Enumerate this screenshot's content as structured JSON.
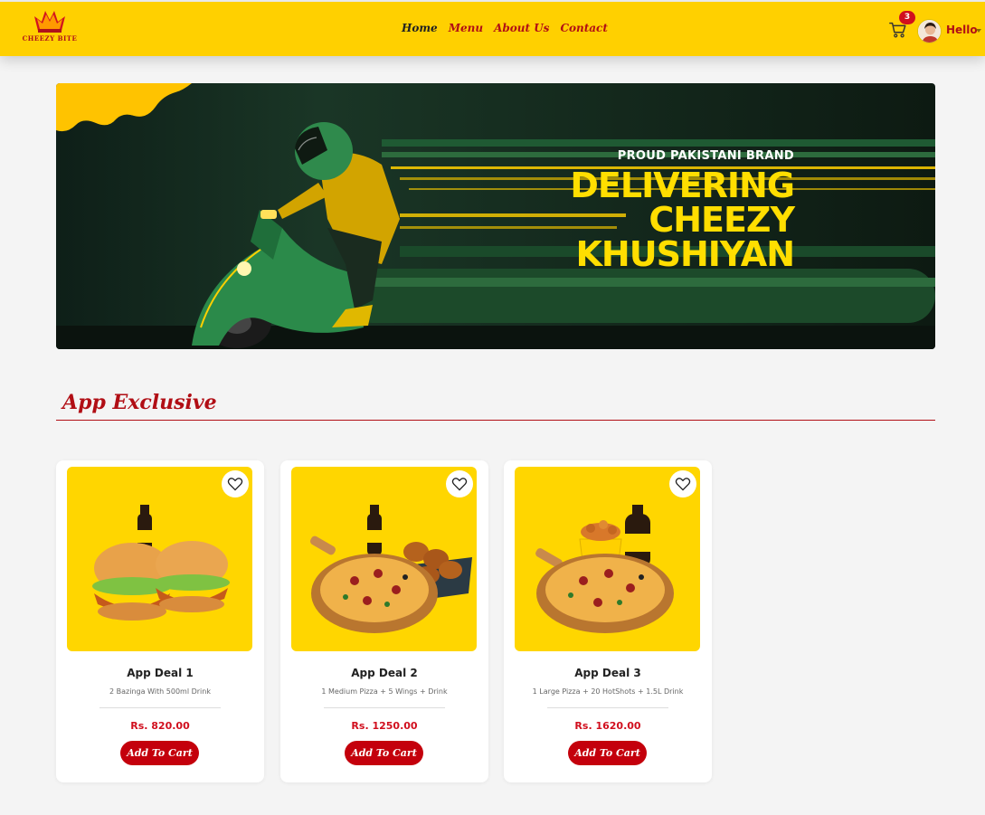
{
  "brand": {
    "logo_text": "CHEEZY BITE"
  },
  "nav": {
    "links": [
      "Home",
      "Menu",
      "About Us",
      "Contact"
    ]
  },
  "header": {
    "cart_count": "3",
    "user_label": "Hello"
  },
  "banner": {
    "tagline": "PROUD PAKISTANI BRAND",
    "line1": "DELIVERING",
    "line2": "CHEEZY",
    "line3": "KHUSHIYAN"
  },
  "section": {
    "title": "App Exclusive"
  },
  "products": [
    {
      "title": "App Deal 1",
      "desc": "2 Bazinga With 500ml Drink",
      "price": "Rs. 820.00",
      "button": "Add To Cart"
    },
    {
      "title": "App Deal 2",
      "desc": "1 Medium Pizza + 5 Wings + Drink",
      "price": "Rs. 1250.00",
      "button": "Add To Cart"
    },
    {
      "title": "App Deal 3",
      "desc": "1 Large Pizza + 20 HotShots + 1.5L Drink",
      "price": "Rs. 1620.00",
      "button": "Add To Cart"
    }
  ],
  "colors": {
    "brand_yellow": "#ffd000",
    "brand_red": "#b10e15",
    "button_red": "#c4000c"
  }
}
